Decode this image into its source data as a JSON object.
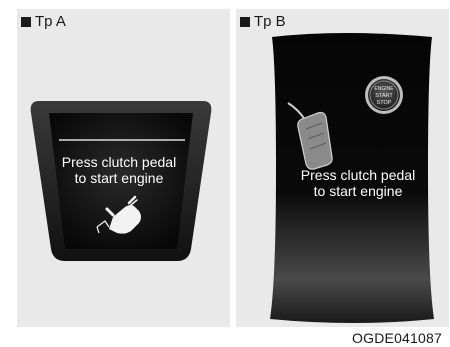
{
  "variant_a": {
    "label": "Tp A",
    "message_line1": "Press clutch pedal",
    "message_line2": "to start engine"
  },
  "variant_b": {
    "label": "Tp B",
    "message_line1": "Press clutch pedal",
    "message_line2": "to start engine",
    "button_line1": "ENGINE",
    "button_line2": "START",
    "button_line3": "STOP"
  },
  "figure_code": "OGDE041087",
  "colors": {
    "panel_bg": "#e9e9e9",
    "display_bg": "#111111",
    "bezel": "#2a2a2a"
  },
  "icons": [
    "square-bullet-icon",
    "hand-pressing-icon",
    "clutch-pedal-icon",
    "engine-start-stop-button-icon"
  ]
}
